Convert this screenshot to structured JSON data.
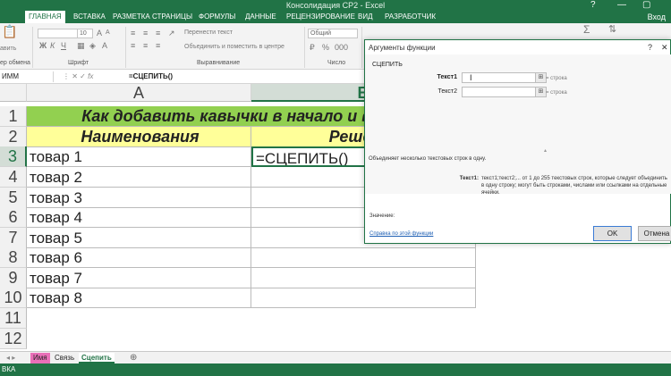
{
  "window": {
    "title": "Консолидация СР2 - Excel",
    "question": "?",
    "minimize": "—",
    "restore": "▢"
  },
  "ribbon_tabs": [
    "ГЛАВНАЯ",
    "ВСТАВКА",
    "РАЗМЕТКА СТРАНИЦЫ",
    "ФОРМУЛЫ",
    "ДАННЫЕ",
    "РЕЦЕНЗИРОВАНИЕ",
    "ВИД",
    "РАЗРАБОТЧИК"
  ],
  "signin": "Вход",
  "ribbon": {
    "paste": "авить",
    "clipboard": "ер обмена",
    "font_size": "10",
    "font_group": "Шрифт",
    "wrap_text": "Перенести текст",
    "merge_center": "Объединить и поместить в центре",
    "alignment_group": "Выравнивание",
    "number_format": "Общий",
    "number_group": "Число",
    "sigma": "Σ"
  },
  "formula_bar": {
    "name_box": "ИММ",
    "formula": "=СЦЕПИТЬ()",
    "fx": "fx"
  },
  "columns": [
    "A",
    "B"
  ],
  "rows": [
    "1",
    "2",
    "3",
    "4",
    "5",
    "6",
    "7",
    "8",
    "9",
    "10",
    "11",
    "12"
  ],
  "cells": {
    "title": "Как добавить кавычки в начало и в конец",
    "header_a": "Наименования",
    "header_b": "Решение",
    "items": [
      "товар 1",
      "товар 2",
      "товар 3",
      "товар 4",
      "товар 5",
      "товар 6",
      "товар 7",
      "товар 8"
    ],
    "active_formula": "=СЦЕПИТЬ()"
  },
  "sheets": [
    "Имя",
    "Связь",
    "Сцепить"
  ],
  "add_sheet": "⊕",
  "status": "ВКА",
  "dialog": {
    "title": "Аргументы функции",
    "function_name": "СЦЕПИТЬ",
    "arg1_label": "Текст1",
    "arg2_label": "Текст2",
    "arg_result": "=  строка",
    "description": "Объединяет несколько текстовых строк в одну.",
    "arg_help_label": "Текст1:",
    "arg_help": "текст1;текст2;... от 1 до 255 текстовых строк, которые следует объединить в одну строку; могут быть строками, числами или ссылками на отдельные ячейки.",
    "value_label": "Значение:",
    "help_link": "Справка по этой функции",
    "ok": "OK",
    "cancel": "Отмена"
  }
}
